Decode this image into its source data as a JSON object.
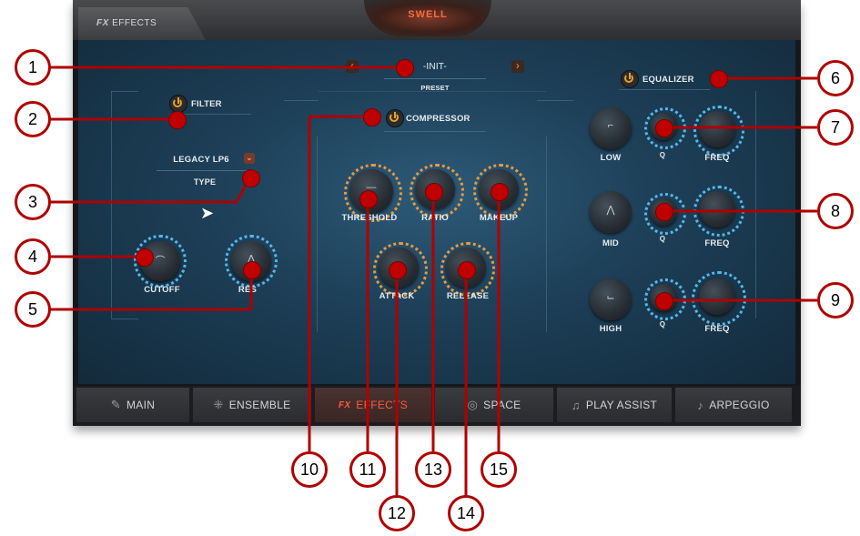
{
  "header": {
    "fx_tab_prefix": "FX",
    "fx_tab_label": "EFFECTS",
    "center_title": "SWELL"
  },
  "preset": {
    "value": "-INIT-",
    "label": "PRESET",
    "prev_glyph": "‹",
    "next_glyph": "›"
  },
  "filter": {
    "title": "FILTER",
    "type_value": "LEGACY LP6",
    "type_label": "TYPE",
    "cutoff_label": "CUTOFF",
    "res_label": "RES"
  },
  "compressor": {
    "title": "COMPRESSOR",
    "threshold_label": "THRESHOLD",
    "ratio_label": "RATIO",
    "makeup_label": "MAKEUP",
    "attack_label": "ATTACK",
    "release_label": "RELEASE"
  },
  "equalizer": {
    "title": "EQUALIZER",
    "low_label": "LOW",
    "mid_label": "MID",
    "high_label": "HIGH",
    "q_label": "Q",
    "freq_label": "FREQ"
  },
  "nav": {
    "tabs": [
      {
        "label": "MAIN",
        "icon": "violin-icon"
      },
      {
        "label": "ENSEMBLE",
        "icon": "ensemble-icon"
      },
      {
        "label": "EFFECTS",
        "prefix": "FX",
        "icon": "fx-icon"
      },
      {
        "label": "SPACE",
        "icon": "space-icon"
      },
      {
        "label": "PLAY ASSIST",
        "icon": "notes-icon"
      },
      {
        "label": "ARPEGGIO",
        "icon": "arpeggio-icon"
      }
    ]
  },
  "callouts": [
    "1",
    "2",
    "3",
    "4",
    "5",
    "6",
    "7",
    "8",
    "9",
    "10",
    "11",
    "12",
    "13",
    "14",
    "15"
  ],
  "colors": {
    "accent_orange": "#f0a020",
    "swell_red": "#ff6a3d",
    "knob_ring_blue": "#53b8ec",
    "knob_ring_orange": "#e89a3c",
    "callout_red": "#c00000"
  }
}
